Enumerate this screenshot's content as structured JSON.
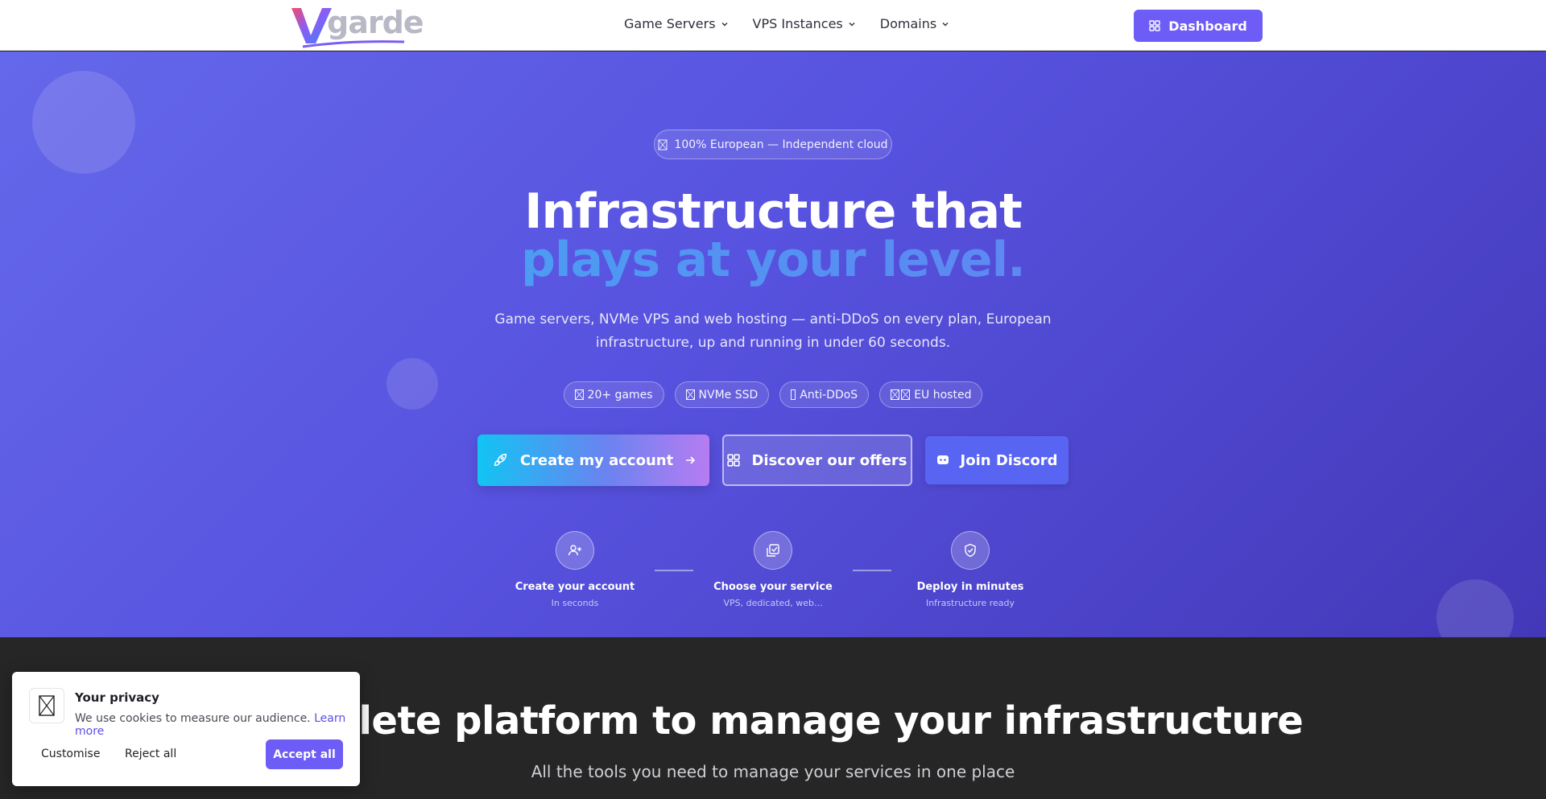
{
  "nav": {
    "logo_text": "garde",
    "links": [
      {
        "label": "Game Servers",
        "icon": "chevron-down-icon"
      },
      {
        "label": "VPS Instances",
        "icon": "chevron-down-icon"
      },
      {
        "label": "Domains",
        "icon": "chevron-down-icon"
      }
    ],
    "dashboard_label": "Dashboard",
    "dashboard_icon": "grid-icon"
  },
  "hero": {
    "badge": "100% European — Independent cloud",
    "title_line1": "Infrastructure that",
    "title_line2": "plays at your level.",
    "subtitle": "Game servers, NVMe VPS and web hosting — anti-DDoS on every plan, European infrastructure, up and running in under 60 seconds.",
    "chips": [
      {
        "label": "20+ games"
      },
      {
        "label": "NVMe SSD"
      },
      {
        "label": "Anti-DDoS"
      },
      {
        "label": "EU hosted"
      }
    ],
    "cta": {
      "create": "Create my account",
      "offers": "Discover our offers",
      "discord": "Join Discord"
    },
    "steps": [
      {
        "title": "Create your account",
        "sub": "In seconds",
        "icon": "user-plus-icon"
      },
      {
        "title": "Choose your service",
        "sub": "VPS, dedicated, web...",
        "icon": "check-square-icon"
      },
      {
        "title": "Deploy in minutes",
        "sub": "Infrastructure ready",
        "icon": "shield-check-icon"
      }
    ]
  },
  "section": {
    "title": "complete platform to manage your infrastructure",
    "subtitle": "All the tools you need to manage your services in one place"
  },
  "cookie": {
    "title": "Your privacy",
    "text": "We use cookies to measure our audience.",
    "link": "Learn more",
    "customise": "Customise",
    "reject": "Reject all",
    "accept": "Accept all"
  },
  "colors": {
    "accent": "#6d5cf5",
    "hero_start": "#6468ea",
    "hero_end": "#4338b8",
    "dark_bg": "#262626"
  }
}
